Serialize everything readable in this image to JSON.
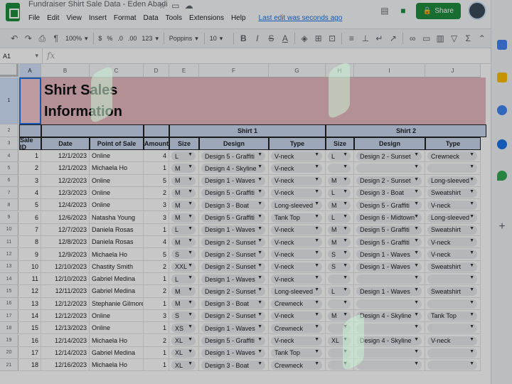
{
  "app": {
    "title": "Fundraiser Shirt Sale Data - Eden Abadi",
    "menu": [
      "File",
      "Edit",
      "View",
      "Insert",
      "Format",
      "Data",
      "Tools",
      "Extensions",
      "Help"
    ],
    "last_edit": "Last edit was seconds ago",
    "share_label": "Share"
  },
  "toolbar": {
    "zoom": "100%",
    "currency": "$",
    "percent": "%",
    "decimals_dec": ".0",
    "decimals_inc": ".00",
    "format": "123",
    "font": "Poppins",
    "font_size": "10"
  },
  "formula": {
    "cell_ref": "A1",
    "fx": "fx"
  },
  "columns": [
    "A",
    "B",
    "C",
    "D",
    "E",
    "F",
    "G",
    "H",
    "I",
    "J"
  ],
  "row_numbers": [
    "1",
    "2",
    "3",
    "4",
    "5",
    "6",
    "7",
    "8",
    "9",
    "10",
    "11",
    "12",
    "13",
    "14",
    "15",
    "16",
    "17",
    "18",
    "19",
    "20",
    "21"
  ],
  "sheet": {
    "title_line1": "Shirt Sales",
    "title_line2": "Information",
    "group1": "Shirt 1",
    "group2": "Shirt 2",
    "headers": [
      "Sale ID",
      "Date",
      "Point of Sale",
      "Amount",
      "Size",
      "Design",
      "Type",
      "Size",
      "Design",
      "Type"
    ],
    "rows": [
      [
        "1",
        "12/1/2023",
        "Online",
        "4",
        "L",
        "Design 5 - Graffiti",
        "V-neck",
        "L",
        "Design 2 - Sunset",
        "Crewneck"
      ],
      [
        "2",
        "12/1/2023",
        "Michaela Ho",
        "1",
        "M",
        "Design 4 - Skyline",
        "V-neck",
        "",
        "",
        ""
      ],
      [
        "3",
        "12/2/2023",
        "Online",
        "5",
        "M",
        "Design 1 - Waves",
        "V-neck",
        "M",
        "Design 2 - Sunset",
        "Long-sleeved"
      ],
      [
        "4",
        "12/3/2023",
        "Online",
        "2",
        "M",
        "Design 5 - Graffiti",
        "V-neck",
        "L",
        "Design 3 - Boat",
        "Sweatshirt"
      ],
      [
        "5",
        "12/4/2023",
        "Online",
        "3",
        "M",
        "Design 3 - Boat",
        "Long-sleeved",
        "M",
        "Design 5 - Graffiti",
        "V-neck"
      ],
      [
        "6",
        "12/6/2023",
        "Natasha Young",
        "3",
        "M",
        "Design 5 - Graffiti",
        "Tank Top",
        "L",
        "Design 6 - Midtown",
        "Long-sleeved"
      ],
      [
        "7",
        "12/7/2023",
        "Daniela Rosas",
        "1",
        "L",
        "Design 1 - Waves",
        "V-neck",
        "M",
        "Design 5 - Graffiti",
        "Sweatshirt"
      ],
      [
        "8",
        "12/8/2023",
        "Daniela Rosas",
        "4",
        "M",
        "Design 2 - Sunset",
        "V-neck",
        "M",
        "Design 5 - Graffiti",
        "V-neck"
      ],
      [
        "9",
        "12/9/2023",
        "Michaela Ho",
        "5",
        "S",
        "Design 2 - Sunset",
        "V-neck",
        "S",
        "Design 1 - Waves",
        "V-neck"
      ],
      [
        "10",
        "12/10/2023",
        "Chastity Smith",
        "2",
        "XXL",
        "Design 2 - Sunset",
        "V-neck",
        "S",
        "Design 1 - Waves",
        "Sweatshirt"
      ],
      [
        "11",
        "12/10/2023",
        "Gabriel Medina",
        "1",
        "L",
        "Design 1 - Waves",
        "V-neck",
        "",
        "",
        ""
      ],
      [
        "12",
        "12/11/2023",
        "Gabriel Medina",
        "2",
        "M",
        "Design 2 - Sunset",
        "Long-sleeved",
        "L",
        "Design 1 - Waves",
        "Sweatshirt"
      ],
      [
        "13",
        "12/12/2023",
        "Stephanie Gilmore",
        "1",
        "M",
        "Design 3 - Boat",
        "Crewneck",
        "",
        "",
        ""
      ],
      [
        "14",
        "12/12/2023",
        "Online",
        "3",
        "S",
        "Design 2 - Sunset",
        "V-neck",
        "M",
        "Design 4 - Skyline",
        "Tank Top"
      ],
      [
        "15",
        "12/13/2023",
        "Online",
        "1",
        "XS",
        "Design 1 - Waves",
        "Crewneck",
        "",
        "",
        ""
      ],
      [
        "16",
        "12/14/2023",
        "Michaela Ho",
        "2",
        "XL",
        "Design 5 - Graffiti",
        "V-neck",
        "XL",
        "Design 4 - Skyline",
        "V-neck"
      ],
      [
        "17",
        "12/14/2023",
        "Gabriel Medina",
        "1",
        "XL",
        "Design 1 - Waves",
        "Tank Top",
        "",
        "",
        ""
      ],
      [
        "18",
        "12/16/2023",
        "Michaela Ho",
        "1",
        "XL",
        "Design 3 - Boat",
        "Crewneck",
        "",
        "",
        ""
      ]
    ]
  },
  "colors": {
    "title_band": "#e6b9c0",
    "header_band": "#c8d8ee",
    "share": "#1e8e3e",
    "selection": "#1a73e8"
  }
}
